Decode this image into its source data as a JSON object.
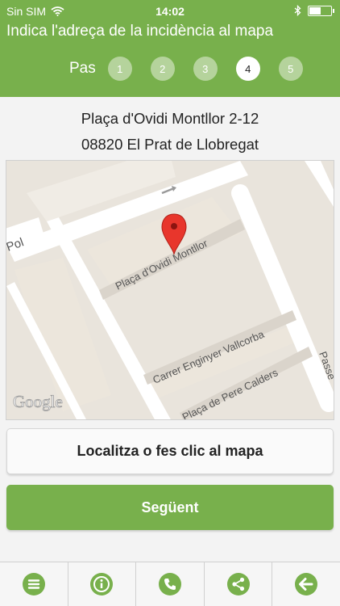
{
  "status_bar": {
    "carrier": "Sin SIM",
    "time": "14:02",
    "battery_level": 0.55
  },
  "header": {
    "title": "Indica l'adreça de la incidència al mapa"
  },
  "steps": {
    "label": "Pas",
    "items": [
      "1",
      "2",
      "3",
      "4",
      "5"
    ],
    "active": "4"
  },
  "address": {
    "line1": "Plaça d'Ovidi Montllor 2-12",
    "line2": "08820 El Prat de Llobregat"
  },
  "map": {
    "streets": [
      "Plaça d'Ovidi Montllor",
      "Carrer Enginyer Vallcorba",
      "Plaça de Pere Calders",
      "Pol",
      "Passe"
    ],
    "logo": "Google"
  },
  "buttons": {
    "locate": "Localitza o fes clic al mapa",
    "next": "Següent"
  },
  "tabbar": {
    "items": [
      "menu-icon",
      "info-icon",
      "phone-icon",
      "share-icon",
      "back-arrow-icon"
    ]
  },
  "colors": {
    "accent": "#78b04c"
  }
}
